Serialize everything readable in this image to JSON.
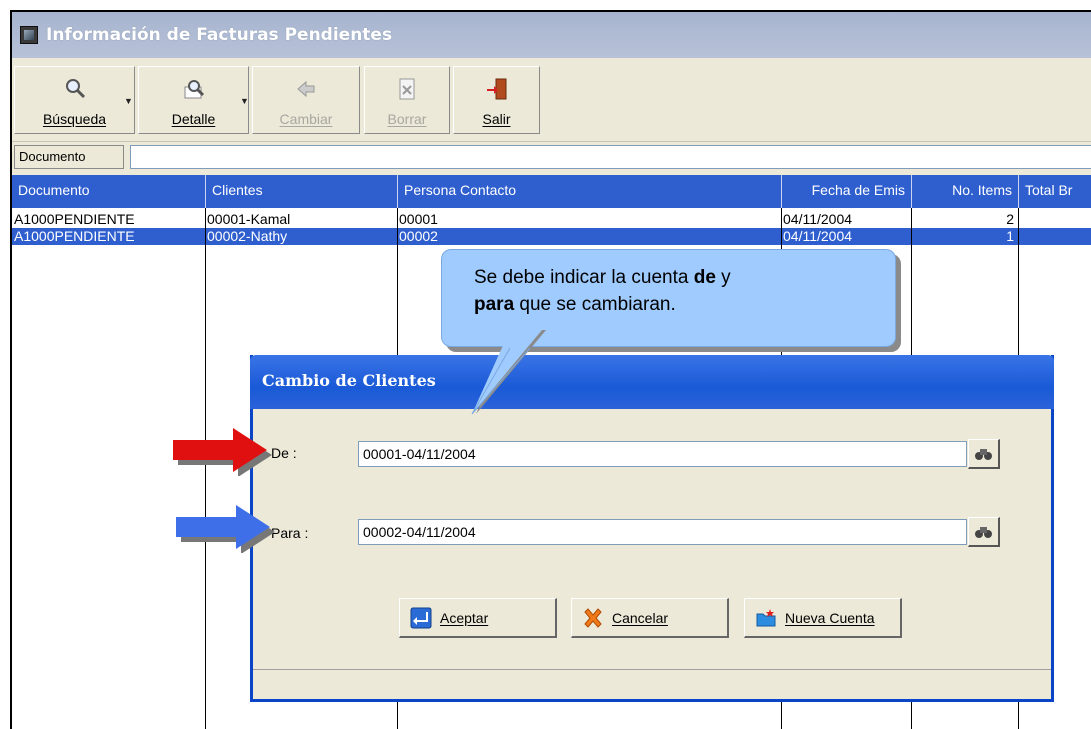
{
  "window": {
    "title": "Información de Facturas Pendientes"
  },
  "toolbar": {
    "buttons": [
      {
        "label": "Búsqueda",
        "icon": "magnifier-icon",
        "enabled": true,
        "dropdown": true
      },
      {
        "label": "Detalle",
        "icon": "detail-magnifier-icon",
        "enabled": true,
        "dropdown": true
      },
      {
        "label": "Cambiar",
        "icon": "change-arrows-icon",
        "enabled": false,
        "dropdown": false
      },
      {
        "label": "Borrar",
        "icon": "delete-page-icon",
        "enabled": false,
        "dropdown": false
      },
      {
        "label": "Salir",
        "icon": "exit-door-icon",
        "enabled": true,
        "dropdown": false
      }
    ]
  },
  "search": {
    "label": "Documento",
    "value": ""
  },
  "grid": {
    "columns": [
      "Documento",
      "Clientes",
      "Persona Contacto",
      "Fecha de Emis",
      "No. Items",
      "Total Br"
    ],
    "rows": [
      {
        "documento": "A1000PENDIENTE",
        "cliente": "00001-Kamal",
        "contacto": "00001",
        "fecha": "04/11/2004",
        "items": "2",
        "selected": false
      },
      {
        "documento": "A1000PENDIENTE",
        "cliente": "00002-Nathy",
        "contacto": "00002",
        "fecha": "04/11/2004",
        "items": "1",
        "selected": true
      }
    ]
  },
  "dialog": {
    "title": "Cambio de Clientes",
    "de_label": "De :",
    "de_value": "00001-04/11/2004",
    "para_label": "Para :",
    "para_value": "00002-04/11/2004",
    "buttons": {
      "accept": "Aceptar",
      "cancel": "Cancelar",
      "new_account": "Nueva Cuenta"
    }
  },
  "callout": {
    "text_part1": "Se debe indicar la cuenta ",
    "bold1": "de",
    "text_part2": " y",
    "bold2": "para",
    "text_part3": " que se cambiaran."
  },
  "colors": {
    "selection": "#2f5fcf",
    "dialog_title": "#1a5ad7",
    "callout_fill": "#9fcbff",
    "arrow_red": "#e01010",
    "arrow_blue": "#3f6fe8"
  }
}
